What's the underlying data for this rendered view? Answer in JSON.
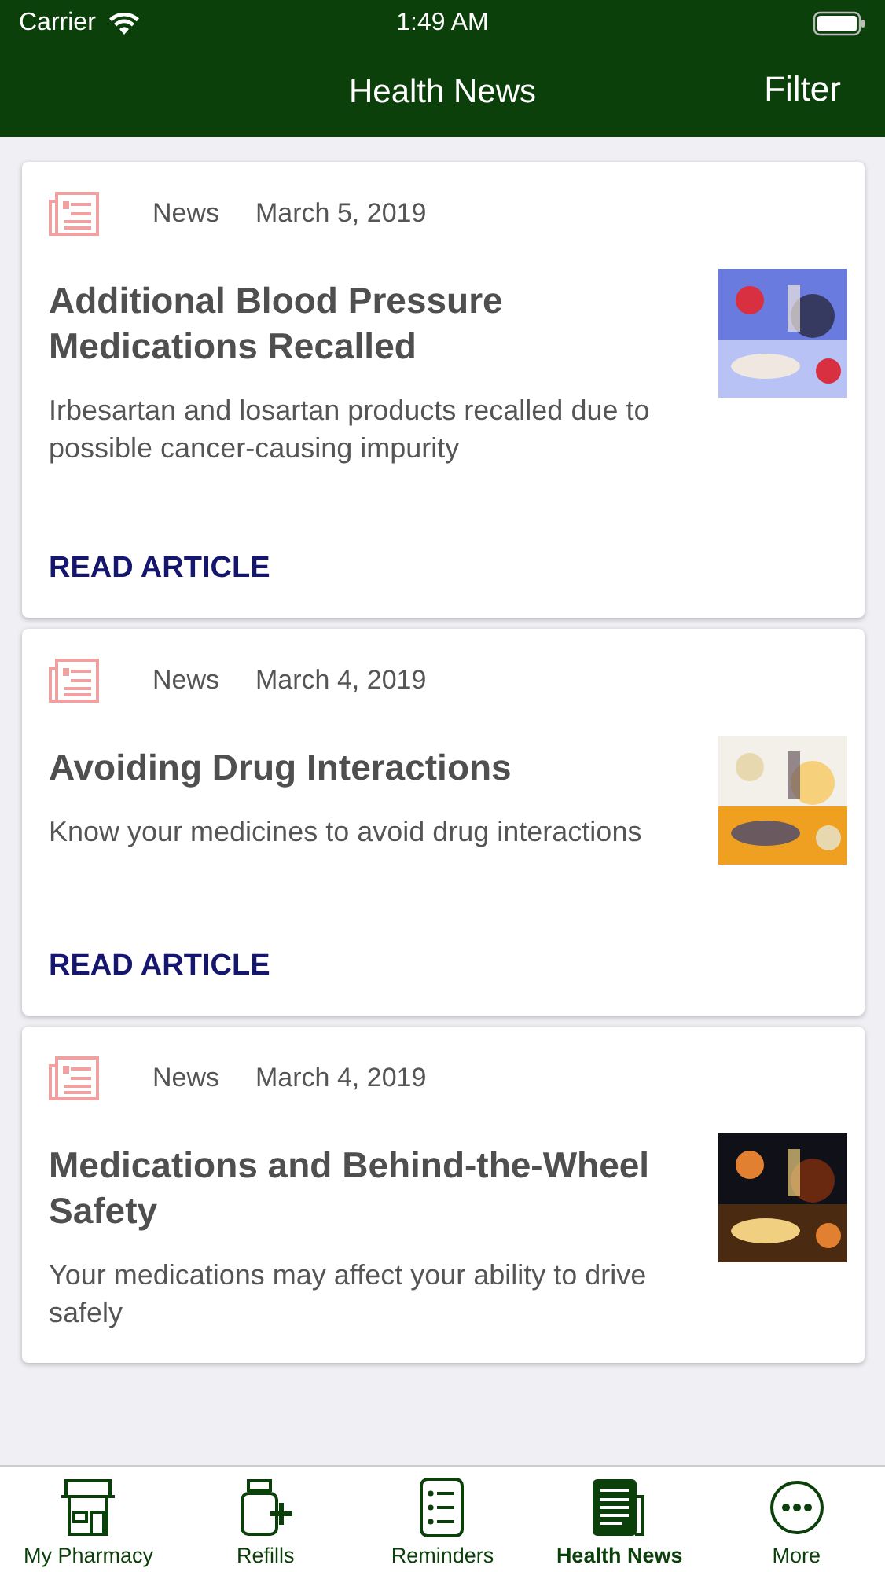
{
  "status_bar": {
    "carrier": "Carrier",
    "time": "1:49 AM"
  },
  "nav_bar": {
    "title": "Health News",
    "action": "Filter"
  },
  "articles": [
    {
      "category": "News",
      "date": "March 5, 2019",
      "title": "Additional Blood Pressure Medications Recalled",
      "summary": "Irbesartan and losartan products recalled due to possible cancer-causing impurity",
      "link": "READ ARTICLE"
    },
    {
      "category": "News",
      "date": "March 4, 2019",
      "title": "Avoiding Drug Interactions",
      "summary": "Know your medicines to avoid drug interactions",
      "link": "READ ARTICLE"
    },
    {
      "category": "News",
      "date": "March 4, 2019",
      "title": "Medications and Behind-the-Wheel Safety",
      "summary": "Your medications may affect your ability to drive safely"
    }
  ],
  "tab_bar": [
    {
      "label": "My Pharmacy",
      "kind": "store",
      "selected": false
    },
    {
      "label": "Refills",
      "kind": "refill",
      "selected": false
    },
    {
      "label": "Reminders",
      "kind": "list",
      "selected": false
    },
    {
      "label": "Health News",
      "kind": "news",
      "selected": true
    },
    {
      "label": "More",
      "kind": "more",
      "selected": false
    }
  ]
}
